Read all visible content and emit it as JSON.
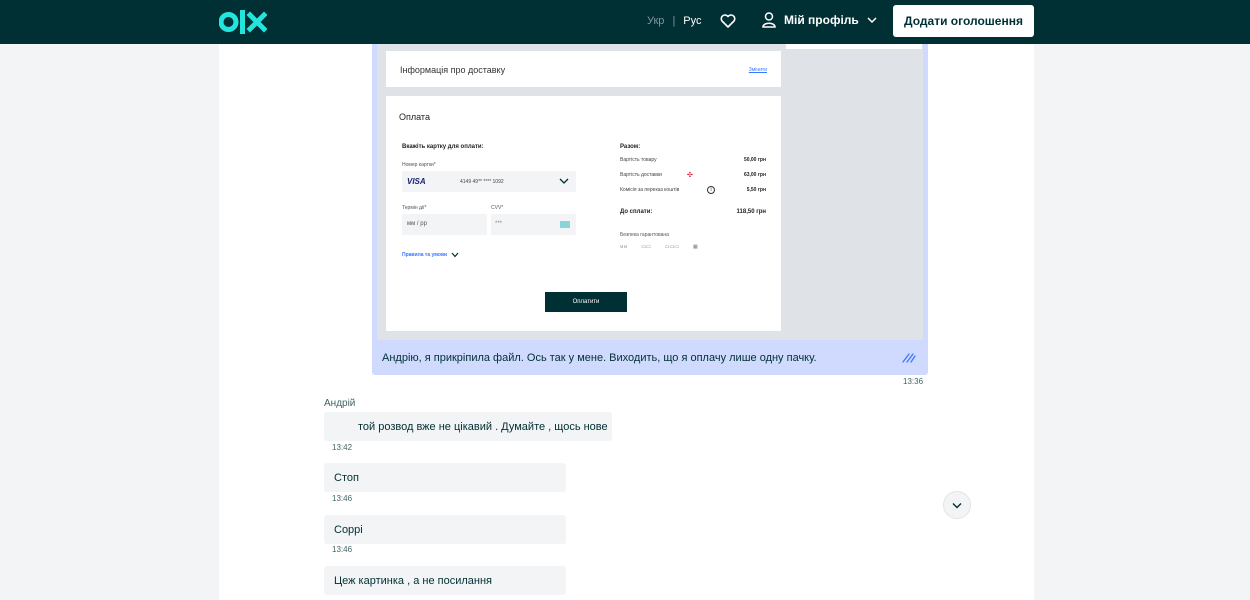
{
  "header": {
    "logo_text": "olx",
    "lang_ukr": "Укр",
    "lang_sep": "|",
    "lang_rus": "Рус",
    "heart_icon": "heart-icon",
    "profile_label": "Мій профіль",
    "add_ad_label": "Додати оголошення"
  },
  "attachment": {
    "delivery_title": "Інформація про доставку",
    "delivery_link": "Змінити",
    "payment_title": "Оплата",
    "card_heading": "Вкажіть картку для оплати:",
    "card_number_label": "Номер картки*",
    "card_brand": "VISA",
    "card_number": "4149 49** **** 1092",
    "expiry_label": "Термін дії*",
    "expiry_placeholder": "мм / рр",
    "cvv_label": "CVV*",
    "cvv_placeholder": "***",
    "rules_label": "Правила та умови",
    "summary_title": "Разом:",
    "rows": [
      {
        "label": "Вартість товару",
        "value": "50,00 грн"
      },
      {
        "label": "Вартість доставки",
        "value": "63,00 грн"
      },
      {
        "label": "Комісія за переказ коштів",
        "value": "5,50 грн"
      }
    ],
    "total_label": "До сплати:",
    "total_value": "118,50 грн",
    "guarantee_label": "Безпека гарантована",
    "pay_button": "Оплатити"
  },
  "messages": {
    "outgoing_text": "Андрію, я прикріпила файл. Ось так у мене. Виходить, що я оплачу лише одну пачку.",
    "outgoing_time": "13:36",
    "author": "Андрій",
    "incoming": [
      {
        "text": "той розвод вже не цікавий . Думайте , щось нове",
        "time": "13:42"
      },
      {
        "text": "Стоп",
        "time": "13:46"
      },
      {
        "text": "Соррі",
        "time": "13:46"
      },
      {
        "text": "Цеж картинка , а не посилання",
        "time": ""
      }
    ]
  },
  "colors": {
    "brand_dark": "#002f34",
    "brand_accent": "#23e5db",
    "outgoing_bubble": "#cfdafe",
    "incoming_bubble": "#f2f4f5"
  }
}
